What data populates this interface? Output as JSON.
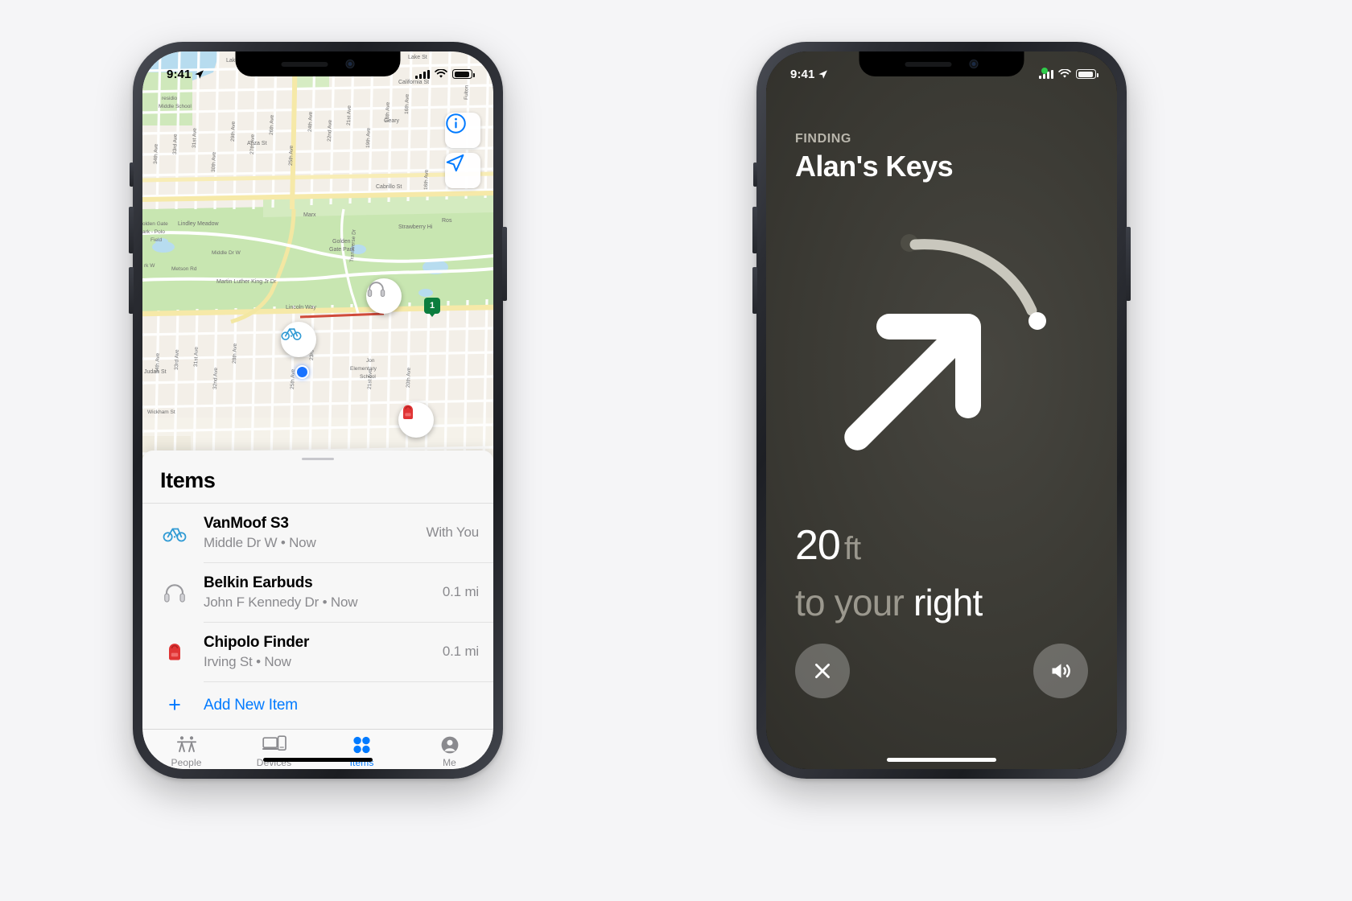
{
  "left_phone": {
    "status_bar": {
      "time": "9:41",
      "location_icon": "location-arrow-icon",
      "signal_icon": "cellular-signal-icon",
      "wifi_icon": "wifi-icon",
      "battery_icon": "battery-icon"
    },
    "map": {
      "info_button_icon": "info-circle-icon",
      "locate_button_icon": "locate-arrow-icon",
      "pins": [
        {
          "name": "headphones-pin",
          "icon": "headphones-icon"
        },
        {
          "name": "bicycle-pin",
          "icon": "bicycle-icon"
        },
        {
          "name": "backpack-pin",
          "icon": "backpack-icon"
        }
      ],
      "user_location_icon": "user-location-dot",
      "park_badge": "1",
      "street_labels": [
        "Lake St",
        "California St",
        "Geary",
        "Cabrillo St",
        "Fulton St",
        "Marx",
        "Lindley Meadow",
        "Golden Gate Park",
        "Strawberry Hi",
        "Golden Gate Park - Polo Field",
        "Middle Dr W",
        "Martin Luther King Jr Dr",
        "Lincoln Way",
        "Judah St",
        "Jon Elementary School",
        "Metson Rd",
        "Ros",
        "Transverse Dr",
        "Anza St",
        "34th Ave",
        "33rd Ave",
        "31st Ave",
        "30th Ave",
        "29th Ave",
        "28th Ave",
        "27th Ave",
        "26th Ave",
        "25th Ave",
        "24th Ave",
        "23rd Ave",
        "22nd Ave",
        "21st Ave",
        "20th Ave",
        "19th Ave",
        "18th Ave",
        "16th Ave",
        "Presidio Middle School",
        "Park W",
        "Wickham St",
        "32nd Ave"
      ]
    },
    "sheet": {
      "title": "Items",
      "items": [
        {
          "name": "VanMoof S3",
          "subtitle": "Middle Dr W • Now",
          "detail": "With You",
          "icon": "bicycle-icon"
        },
        {
          "name": "Belkin Earbuds",
          "subtitle": "John F Kennedy Dr • Now",
          "detail": "0.1 mi",
          "icon": "headphones-icon"
        },
        {
          "name": "Chipolo Finder",
          "subtitle": "Irving St • Now",
          "detail": "0.1 mi",
          "icon": "backpack-icon"
        }
      ],
      "add_item_label": "Add New Item",
      "add_item_icon": "plus-icon"
    },
    "tabs": [
      {
        "label": "People",
        "icon": "people-icon",
        "active": false
      },
      {
        "label": "Devices",
        "icon": "devices-icon",
        "active": false
      },
      {
        "label": "Items",
        "icon": "items-grid-icon",
        "active": true
      },
      {
        "label": "Me",
        "icon": "person-circle-icon",
        "active": false
      }
    ]
  },
  "right_phone": {
    "status_bar": {
      "time": "9:41",
      "location_icon": "location-arrow-icon",
      "signal_icon": "cellular-signal-icon",
      "wifi_icon": "wifi-icon",
      "battery_icon": "battery-icon"
    },
    "finding_label": "FINDING",
    "item_name": "Alan's Keys",
    "direction_arrow_icon": "direction-arrow-icon",
    "distance_value": "20",
    "distance_unit": "ft",
    "direction_prefix": "to your",
    "direction_word": "right",
    "close_button_icon": "close-x-icon",
    "sound_button_icon": "speaker-wave-icon"
  },
  "colors": {
    "accent_blue": "#007aff",
    "page_background": "#f5f5f7",
    "sheet_background": "#f7f7f7",
    "dark_screen": "#3a3933",
    "muted_text": "#8a8a8e"
  }
}
